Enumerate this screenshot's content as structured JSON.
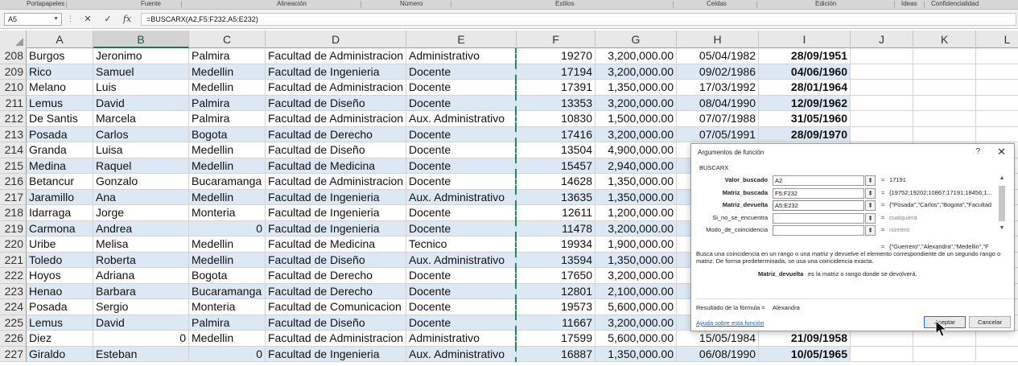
{
  "ribbon": {
    "groups": [
      "Portapapeles",
      "Fuente",
      "Alineación",
      "Número",
      "Estilos",
      "Celdas",
      "Edición",
      "Ideas",
      "Confidencialidad"
    ]
  },
  "formula_bar": {
    "name_box": "A5",
    "cancel_icon": "✕",
    "enter_icon": "✓",
    "fx_label": "fx",
    "formula": "=BUSCARX(A2,F5:F232,A5:E232)"
  },
  "columns": [
    "A",
    "B",
    "C",
    "D",
    "E",
    "F",
    "G",
    "H",
    "I",
    "J",
    "K",
    "L"
  ],
  "selected_column": "B",
  "rows": [
    {
      "num": "208",
      "a": "Burgos",
      "b": "Jeronimo",
      "c": "Palmira",
      "d": "Facultad de Administracion",
      "e": "Administrativo",
      "f": "19270",
      "g": "3,200,000.00",
      "h": "05/04/1982",
      "i": "28/09/1951"
    },
    {
      "num": "209",
      "a": "Rico",
      "b": "Samuel",
      "c": "Medellin",
      "d": "Facultad de Ingenieria",
      "e": "Docente",
      "f": "17194",
      "g": "3,200,000.00",
      "h": "09/02/1986",
      "i": "04/06/1960"
    },
    {
      "num": "210",
      "a": "Melano",
      "b": "Luis",
      "c": "Medellin",
      "d": "Facultad de Administracion",
      "e": "Docente",
      "f": "17391",
      "g": "1,350,000.00",
      "h": "17/03/1992",
      "i": "28/01/1964"
    },
    {
      "num": "211",
      "a": "Lemus",
      "b": "David",
      "c": "Palmira",
      "d": "Facultad de Diseño",
      "e": "Docente",
      "f": "13353",
      "g": "3,200,000.00",
      "h": "08/04/1990",
      "i": "12/09/1962"
    },
    {
      "num": "212",
      "a": "De Santis",
      "b": "Marcela",
      "c": "Palmira",
      "d": "Facultad de Administracion",
      "e": "Aux. Administrativo",
      "f": "10830",
      "g": "1,500,000.00",
      "h": "07/07/1988",
      "i": "31/05/1960"
    },
    {
      "num": "213",
      "a": "Posada",
      "b": "Carlos",
      "c": "Bogota",
      "d": "Facultad de Derecho",
      "e": "Docente",
      "f": "17416",
      "g": "3,200,000.00",
      "h": "07/05/1991",
      "i": "28/09/1970"
    },
    {
      "num": "214",
      "a": "Granda",
      "b": "Luisa",
      "c": "Medellin",
      "d": "Facultad de Diseño",
      "e": "Docente",
      "f": "13504",
      "g": "4,900,000.00",
      "h": "",
      "i": ""
    },
    {
      "num": "215",
      "a": "Medina",
      "b": "Raquel",
      "c": "Medellin",
      "d": "Facultad de Medicina",
      "e": "Docente",
      "f": "15457",
      "g": "2,940,000.00",
      "h": "",
      "i": ""
    },
    {
      "num": "216",
      "a": "Betancur",
      "b": "Gonzalo",
      "c": "Bucaramanga",
      "d": "Facultad de Administracion",
      "e": "Docente",
      "f": "14628",
      "g": "1,350,000.00",
      "h": "",
      "i": ""
    },
    {
      "num": "217",
      "a": "Jaramillo",
      "b": "Ana",
      "c": "Medellin",
      "d": "Facultad de Ingenieria",
      "e": "Aux. Administrativo",
      "f": "13635",
      "g": "1,350,000.00",
      "h": "",
      "i": ""
    },
    {
      "num": "218",
      "a": "Idarraga",
      "b": "Jorge",
      "c": "Monteria",
      "d": "Facultad de Ingenieria",
      "e": "Docente",
      "f": "12611",
      "g": "1,200,000.00",
      "h": "",
      "i": ""
    },
    {
      "num": "219",
      "a": "Carmona",
      "b": "Andrea",
      "c": "0",
      "d": "Facultad de Ingenieria",
      "e": "Docente",
      "f": "11478",
      "g": "3,200,000.00",
      "h": "",
      "i": ""
    },
    {
      "num": "220",
      "a": "Uribe",
      "b": "Melisa",
      "c": "Medellin",
      "d": "Facultad de Medicina",
      "e": "Tecnico",
      "f": "19934",
      "g": "1,900,000.00",
      "h": "",
      "i": ""
    },
    {
      "num": "221",
      "a": "Toledo",
      "b": "Roberta",
      "c": "Medellin",
      "d": "Facultad de Diseño",
      "e": "Aux. Administrativo",
      "f": "13594",
      "g": "1,350,000.00",
      "h": "",
      "i": ""
    },
    {
      "num": "222",
      "a": "Hoyos",
      "b": "Adriana",
      "c": "Bogota",
      "d": "Facultad de Derecho",
      "e": "Docente",
      "f": "17650",
      "g": "3,200,000.00",
      "h": "",
      "i": ""
    },
    {
      "num": "223",
      "a": "Henao",
      "b": "Barbara",
      "c": "Bucaramanga",
      "d": "Facultad de Derecho",
      "e": "Docente",
      "f": "12801",
      "g": "2,100,000.00",
      "h": "",
      "i": ""
    },
    {
      "num": "224",
      "a": "Posada",
      "b": "Sergio",
      "c": "Monteria",
      "d": "Facultad de Comunicacion",
      "e": "Docente",
      "f": "19573",
      "g": "5,600,000.00",
      "h": "",
      "i": ""
    },
    {
      "num": "225",
      "a": "Lemus",
      "b": "David",
      "c": "Palmira",
      "d": "Facultad de Diseño",
      "e": "Docente",
      "f": "11667",
      "g": "3,200,000.00",
      "h": "",
      "i": ""
    },
    {
      "num": "226",
      "a": "Diez",
      "b": "0",
      "c": "Medellin",
      "d": "Facultad de Administracion",
      "e": "Administrativo",
      "f": "17599",
      "g": "5,600,000.00",
      "h": "15/05/1984",
      "i": "21/09/1958"
    },
    {
      "num": "227",
      "a": "Giraldo",
      "b": "Esteban",
      "c": "0",
      "d": "Facultad de Ingenieria",
      "e": "Aux. Administrativo",
      "f": "16887",
      "g": "1,350,000.00",
      "h": "06/08/1990",
      "i": "10/05/1965"
    }
  ],
  "dialog": {
    "title": "Argumentos de función",
    "help": "?",
    "close": "✕",
    "function_name": "BUSCARX",
    "args": [
      {
        "label": "Valor_buscado",
        "value": "A2",
        "result": "17191",
        "hint": false
      },
      {
        "label": "Matriz_buscada",
        "value": "F5:F232",
        "result": "{19752;19202;10867;17191;18456;1...",
        "hint": false
      },
      {
        "label": "Matriz_devuelta",
        "value": "A5:E232",
        "result": "{\"Posada\",\"Carlos\",\"Bogota\",\"Facultad",
        "hint": false
      },
      {
        "label": "Si_no_se_encuentra",
        "value": "",
        "result": "cualquiera",
        "hint": true
      },
      {
        "label": "Modo_de_coincidencia",
        "value": "",
        "result": "número",
        "hint": true
      }
    ],
    "result_preview": "{\"Guerrero\",\"Alexandra\",\"Medellin\",\"F",
    "description": "Busca una coincidencia en un rango o una matriz y devuelve el elemento correspondiente de un segundo rango o matriz. De forma predeterminada, se usa una coincidencia exacta.",
    "arg_name": "Matriz_devuelta",
    "arg_description": "es la matriz o rango donde se devolverá.",
    "result_label": "Resultado de la fórmula =",
    "result_value": "Alexandra",
    "help_link": "Ayuda sobre esta función",
    "ok_label": "Aceptar",
    "cancel_label": "Cancelar"
  },
  "colors": {
    "band": "#dce8f3",
    "accent": "#217346",
    "marquee": "#1e8a56",
    "link": "#1f5fbf"
  }
}
